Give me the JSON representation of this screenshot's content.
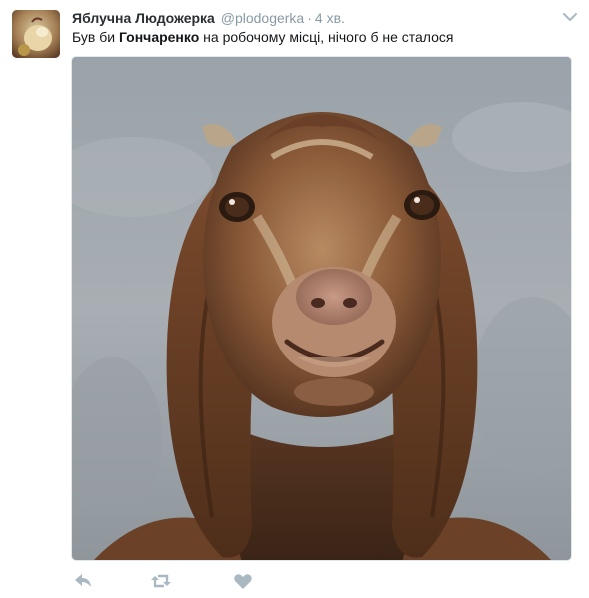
{
  "tweet": {
    "author_name": "Яблучна Людожерка",
    "author_handle": "@plodogerka",
    "separator": "·",
    "time": "4 хв.",
    "text_before": "Був би ",
    "text_bold": "Гончаренко",
    "text_after": " на робочому місці,  нічого б не сталося"
  },
  "icons": {
    "caret": "chevron-down-icon",
    "reply": "reply-icon",
    "retweet": "retweet-icon",
    "like": "heart-icon"
  },
  "colors": {
    "muted": "#8899a6",
    "text": "#14171a",
    "icon": "#aab8c2"
  }
}
